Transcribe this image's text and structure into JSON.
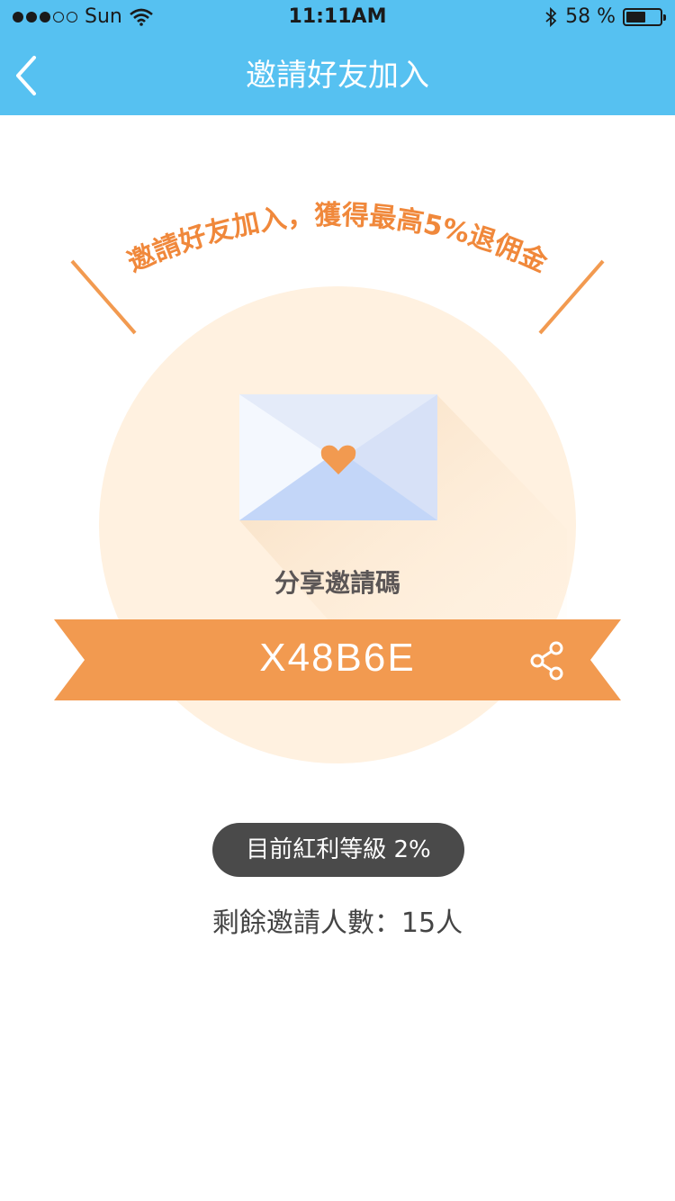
{
  "status_bar": {
    "carrier": "Sun",
    "time": "11:11AM",
    "battery_text": "58 %",
    "battery_level": 0.58,
    "icons": [
      "signal-dots-icon",
      "wifi-icon",
      "bluetooth-icon",
      "battery-icon"
    ]
  },
  "nav": {
    "title": "邀請好友加入",
    "back_icon": "chevron-left-icon"
  },
  "hero": {
    "headline": "邀請好友加入，獲得最高5%退佣金",
    "share_title": "分享邀請碼",
    "invite_code": "X48B6E",
    "share_icon": "share-icon",
    "envelope_icon": "envelope-heart-icon"
  },
  "info": {
    "level_badge": "目前紅利等級 2%",
    "remaining": "剩餘邀請人數：15人"
  },
  "colors": {
    "header_blue": "#56c1f1",
    "accent_orange": "#f29a50",
    "circle_cream": "#fff1e0",
    "badge_gray": "#4a4a4a"
  }
}
